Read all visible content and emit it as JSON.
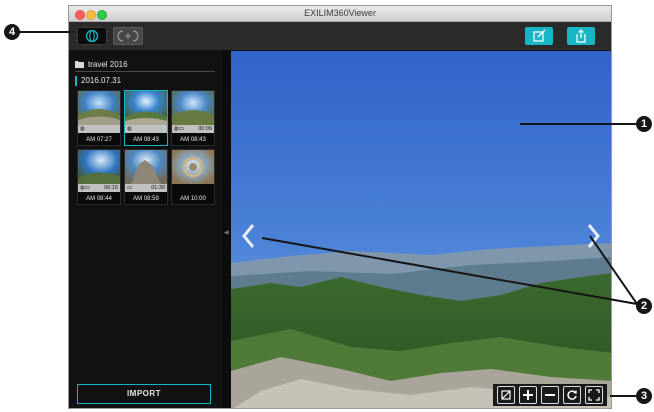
{
  "window": {
    "title": "EXILIM360Viewer"
  },
  "toolbar": {
    "mode_360_icon": "sphere-icon",
    "mode_dual_icon": "dual-lens-icon",
    "edit_icon": "edit-icon",
    "share_icon": "share-icon"
  },
  "sidebar": {
    "folder_label": "travel 2016",
    "date_label": "2016.07.31",
    "thumbnails": [
      {
        "time": "AM 07:27",
        "badge": "",
        "selected": false
      },
      {
        "time": "AM 08:43",
        "badge": "",
        "selected": true
      },
      {
        "time": "AM 08:43",
        "badge": "00:09",
        "selected": false
      },
      {
        "time": "AM 08:44",
        "badge": "00:15",
        "selected": false
      },
      {
        "time": "AM 08:59",
        "badge": "01:30",
        "selected": false
      },
      {
        "time": "AM 10:00",
        "badge": "",
        "selected": false
      }
    ],
    "import_label": "IMPORT"
  },
  "viewer": {
    "tools": [
      "crop-icon",
      "zoom-in-icon",
      "zoom-out-icon",
      "rotate-icon",
      "fullscreen-icon"
    ]
  },
  "callouts": [
    "1",
    "2",
    "3",
    "4"
  ],
  "colors": {
    "accent": "#18b6c4",
    "background": "#1b1b1b"
  }
}
